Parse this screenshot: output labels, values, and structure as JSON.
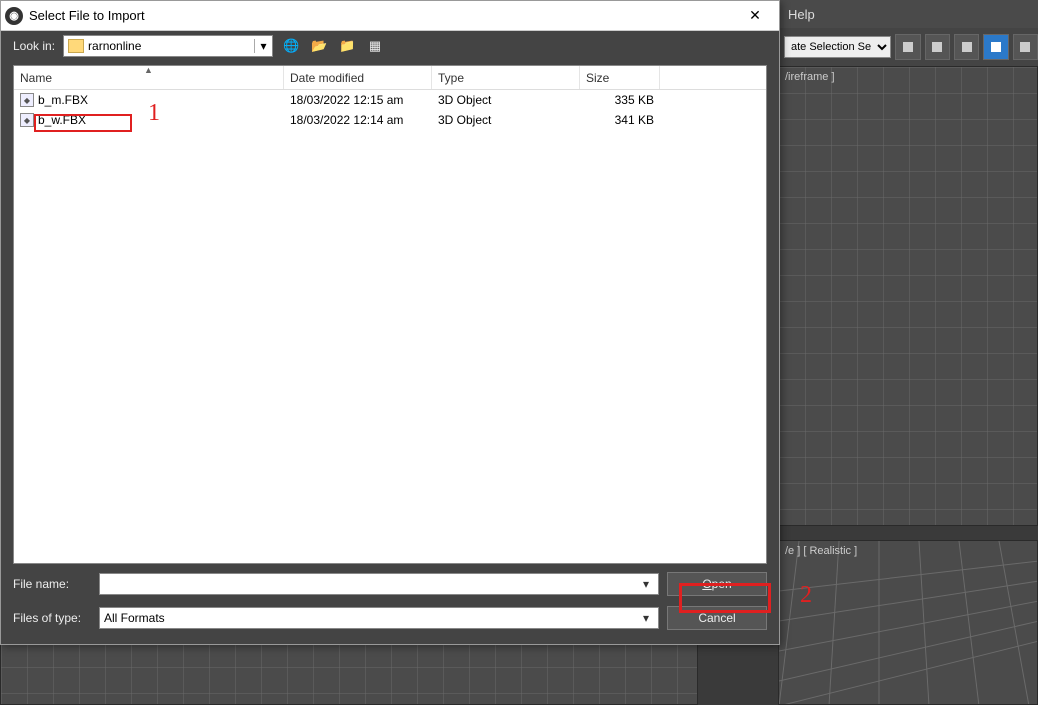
{
  "app_menu": {
    "help": "Help"
  },
  "toolbar": {
    "selection_set": "ate Selection Se"
  },
  "viewport": {
    "top_label": "/ireframe ]",
    "bottom_label": "/e ] [ Realistic ]"
  },
  "dialog": {
    "title": "Select File to Import",
    "lookin_label": "Look in:",
    "lookin_value": "rarnonline",
    "columns": {
      "name": "Name",
      "date": "Date modified",
      "type": "Type",
      "size": "Size"
    },
    "rows": [
      {
        "name": "b_m.FBX",
        "date": "18/03/2022 12:15 am",
        "type": "3D Object",
        "size": "335 KB"
      },
      {
        "name": "b_w.FBX",
        "date": "18/03/2022 12:14 am",
        "type": "3D Object",
        "size": "341 KB"
      }
    ],
    "filename_label": "File name:",
    "filename_value": "",
    "filetype_label": "Files of type:",
    "filetype_value": "All Formats",
    "open_btn": "Open",
    "cancel_btn": "Cancel"
  },
  "annot": {
    "one": "1",
    "two": "2"
  }
}
